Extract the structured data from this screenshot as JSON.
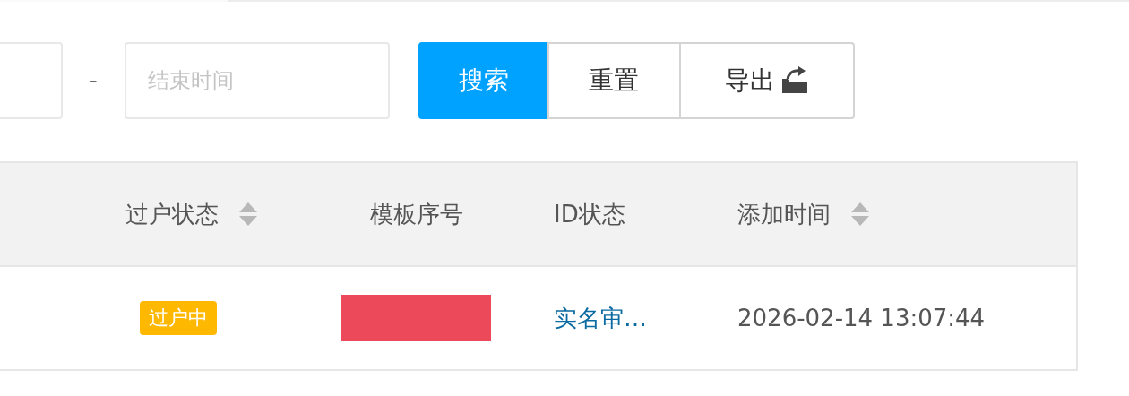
{
  "filters": {
    "start_field": {
      "kind": "partial"
    },
    "separator": "-",
    "end_field": {
      "placeholder": "结束时间",
      "kind": "full"
    },
    "buttons": [
      {
        "label": "搜索",
        "kind": "primary"
      },
      {
        "label": "重置",
        "kind": "plain"
      },
      {
        "label": "导出",
        "kind": "export"
      }
    ]
  },
  "table": {
    "columns": [
      {
        "label": "过户状态",
        "sortable": true
      },
      {
        "label": "模板序号",
        "sortable": false
      },
      {
        "label": "ID状态",
        "sortable": false
      },
      {
        "label": "添加时间",
        "sortable": true
      }
    ],
    "rows": [
      {
        "status": {
          "text": "过户中",
          "color": "#ffb800"
        },
        "template": {
          "kind": "redacted"
        },
        "id_status": "实名审…",
        "added": "2026-02-14 13:07:44"
      }
    ]
  }
}
